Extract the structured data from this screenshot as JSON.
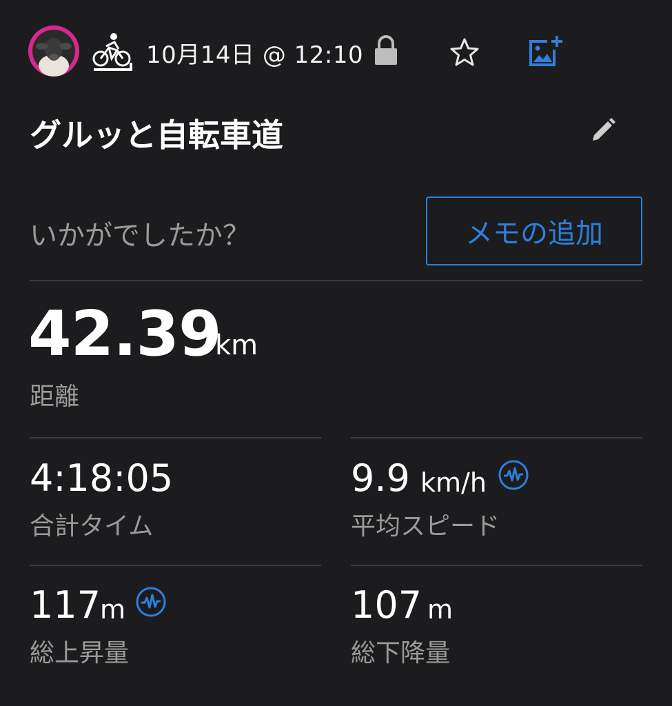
{
  "header": {
    "date": "10月14日 @ 12:10",
    "icons": [
      "avatar",
      "cycling-icon",
      "lock-icon",
      "star-icon",
      "add-photo-icon"
    ]
  },
  "activity": {
    "title": "グルッと自転車道"
  },
  "notes": {
    "prompt": "いかがでしたか？",
    "add_memo_label": "メモの追加"
  },
  "stats": {
    "distance": {
      "value": "42.39",
      "unit": "km",
      "label": "距離"
    },
    "total_time": {
      "value": "4:18:05",
      "label": "合計タイム"
    },
    "avg_speed": {
      "value": "9.9",
      "unit": "km/h",
      "label": "平均スピード"
    },
    "total_ascent": {
      "value": "117",
      "unit": "m",
      "label": "総上昇量"
    },
    "total_descent": {
      "value": "107",
      "unit": "m",
      "label": "総下降量"
    }
  },
  "colors": {
    "background": "#1c1c1e",
    "accent": "#2f7fdb",
    "secondary_text": "#9a9a9a",
    "avatar_bg": "#d6288d"
  }
}
